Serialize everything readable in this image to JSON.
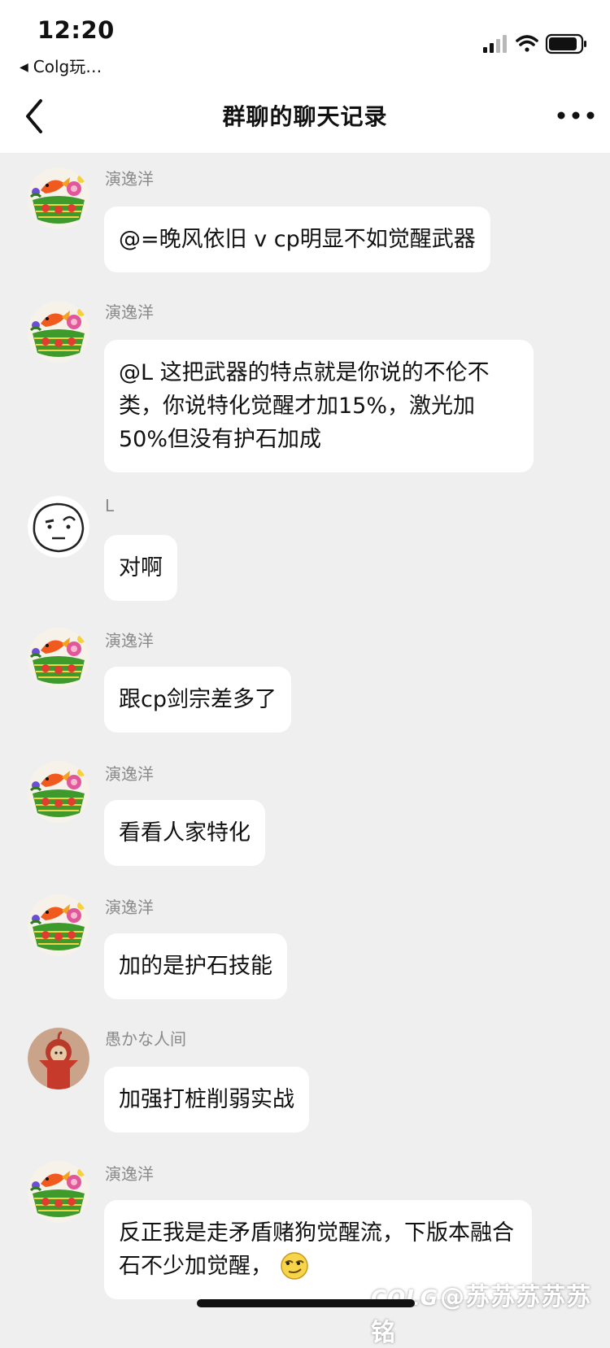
{
  "status_bar": {
    "time": "12:20",
    "back_app_label": "Colg玩…",
    "signal_icon": "cellular-signal-icon",
    "wifi_icon": "wifi-icon",
    "battery_icon": "battery-icon"
  },
  "nav": {
    "title": "群聊的聊天记录",
    "back_icon": "chevron-left-icon",
    "more_icon": "more-dots-icon"
  },
  "messages": [
    {
      "sender": "演逸洋",
      "text": "@=晚风依旧 v cp明显不如觉醒武器",
      "avatar": "fish-flower-basket-avatar"
    },
    {
      "sender": "演逸洋",
      "text": "@L 这把武器的特点就是你说的不伦不类，你说特化觉醒才加15%，激光加50%但没有护石加成",
      "avatar": "fish-flower-basket-avatar"
    },
    {
      "sender": "L",
      "text": "对啊",
      "avatar": "doodle-face-avatar"
    },
    {
      "sender": "演逸洋",
      "text": "跟cp剑宗差多了",
      "avatar": "fish-flower-basket-avatar"
    },
    {
      "sender": "演逸洋",
      "text": "看看人家特化",
      "avatar": "fish-flower-basket-avatar"
    },
    {
      "sender": "演逸洋",
      "text": "加的是护石技能",
      "avatar": "fish-flower-basket-avatar"
    },
    {
      "sender": "愚かな人间",
      "text": "加强打桩削弱实战",
      "avatar": "red-teletubby-avatar"
    },
    {
      "sender": "演逸洋",
      "text": "反正我是走矛盾赌狗觉醒流，下版本融合石不少加觉醒，",
      "avatar": "fish-flower-basket-avatar",
      "emoji": "smirk-emoji-icon"
    }
  ],
  "watermark": {
    "logo": "COLG",
    "text": "@苏苏苏苏苏铭"
  },
  "colors": {
    "background": "#efefef",
    "bubble": "#ffffff",
    "name_gray": "#8a8a8a"
  }
}
